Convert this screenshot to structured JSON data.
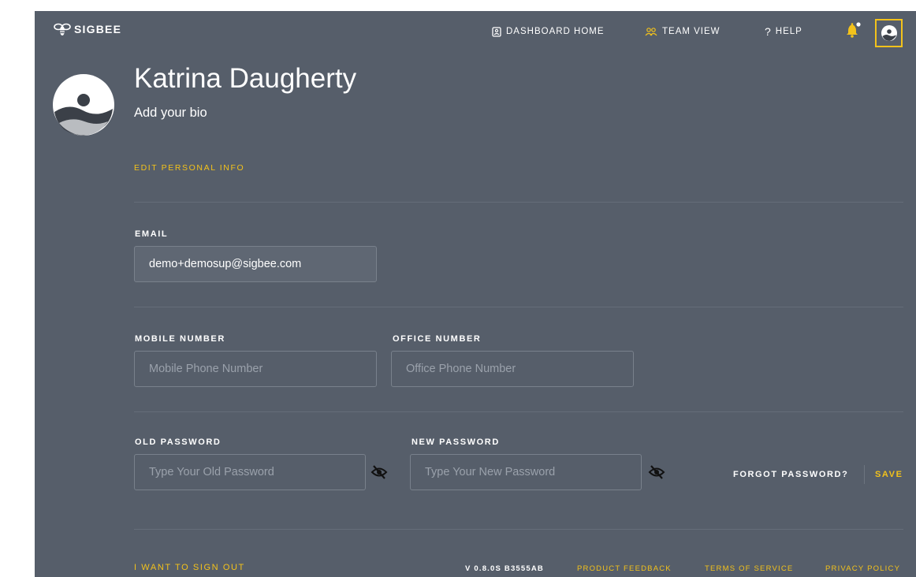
{
  "app": {
    "logo_text": "SIGBEE",
    "accent_color": "#f3c21b",
    "background_color": "#565e6a"
  },
  "nav": {
    "dashboard_home": "DASHBOARD HOME",
    "team_view": "TEAM VIEW",
    "help": "HELP",
    "help_icon_glyph": "?",
    "icons": [
      "dashboard-icon",
      "team-icon",
      "help-icon",
      "bell-icon",
      "profile-avatar-icon"
    ]
  },
  "profile": {
    "name": "Katrina Daugherty",
    "bio_prompt": "Add your bio",
    "edit_link": "EDIT PERSONAL INFO"
  },
  "form": {
    "email": {
      "label": "EMAIL",
      "value": "demo+demosup@sigbee.com"
    },
    "mobile": {
      "label": "MOBILE NUMBER",
      "placeholder": "Mobile Phone Number"
    },
    "office": {
      "label": "OFFICE NUMBER",
      "placeholder": "Office Phone Number"
    },
    "old_password": {
      "label": "OLD PASSWORD",
      "placeholder": "Type Your Old Password"
    },
    "new_password": {
      "label": "NEW PASSWORD",
      "placeholder": "Type Your New Password"
    },
    "forgot_password": "FORGOT PASSWORD?",
    "save": "SAVE"
  },
  "footer": {
    "sign_out": "I WANT TO SIGN OUT",
    "version": "V 0.8.0S B3555AB",
    "product_feedback": "PRODUCT FEEDBACK",
    "terms": "TERMS OF SERVICE",
    "privacy": "PRIVACY POLICY"
  }
}
